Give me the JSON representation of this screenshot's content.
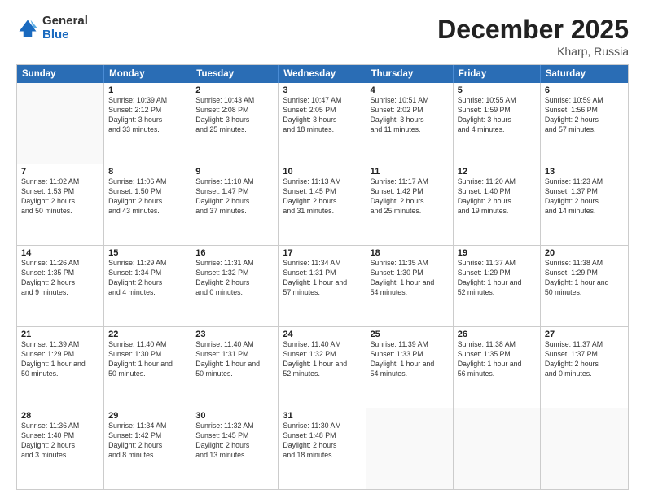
{
  "logo": {
    "general": "General",
    "blue": "Blue"
  },
  "title": {
    "month": "December 2025",
    "location": "Kharp, Russia"
  },
  "header_days": [
    "Sunday",
    "Monday",
    "Tuesday",
    "Wednesday",
    "Thursday",
    "Friday",
    "Saturday"
  ],
  "weeks": [
    [
      {
        "day": "",
        "info": ""
      },
      {
        "day": "1",
        "info": "Sunrise: 10:39 AM\nSunset: 2:12 PM\nDaylight: 3 hours\nand 33 minutes."
      },
      {
        "day": "2",
        "info": "Sunrise: 10:43 AM\nSunset: 2:08 PM\nDaylight: 3 hours\nand 25 minutes."
      },
      {
        "day": "3",
        "info": "Sunrise: 10:47 AM\nSunset: 2:05 PM\nDaylight: 3 hours\nand 18 minutes."
      },
      {
        "day": "4",
        "info": "Sunrise: 10:51 AM\nSunset: 2:02 PM\nDaylight: 3 hours\nand 11 minutes."
      },
      {
        "day": "5",
        "info": "Sunrise: 10:55 AM\nSunset: 1:59 PM\nDaylight: 3 hours\nand 4 minutes."
      },
      {
        "day": "6",
        "info": "Sunrise: 10:59 AM\nSunset: 1:56 PM\nDaylight: 2 hours\nand 57 minutes."
      }
    ],
    [
      {
        "day": "7",
        "info": "Sunrise: 11:02 AM\nSunset: 1:53 PM\nDaylight: 2 hours\nand 50 minutes."
      },
      {
        "day": "8",
        "info": "Sunrise: 11:06 AM\nSunset: 1:50 PM\nDaylight: 2 hours\nand 43 minutes."
      },
      {
        "day": "9",
        "info": "Sunrise: 11:10 AM\nSunset: 1:47 PM\nDaylight: 2 hours\nand 37 minutes."
      },
      {
        "day": "10",
        "info": "Sunrise: 11:13 AM\nSunset: 1:45 PM\nDaylight: 2 hours\nand 31 minutes."
      },
      {
        "day": "11",
        "info": "Sunrise: 11:17 AM\nSunset: 1:42 PM\nDaylight: 2 hours\nand 25 minutes."
      },
      {
        "day": "12",
        "info": "Sunrise: 11:20 AM\nSunset: 1:40 PM\nDaylight: 2 hours\nand 19 minutes."
      },
      {
        "day": "13",
        "info": "Sunrise: 11:23 AM\nSunset: 1:37 PM\nDaylight: 2 hours\nand 14 minutes."
      }
    ],
    [
      {
        "day": "14",
        "info": "Sunrise: 11:26 AM\nSunset: 1:35 PM\nDaylight: 2 hours\nand 9 minutes."
      },
      {
        "day": "15",
        "info": "Sunrise: 11:29 AM\nSunset: 1:34 PM\nDaylight: 2 hours\nand 4 minutes."
      },
      {
        "day": "16",
        "info": "Sunrise: 11:31 AM\nSunset: 1:32 PM\nDaylight: 2 hours\nand 0 minutes."
      },
      {
        "day": "17",
        "info": "Sunrise: 11:34 AM\nSunset: 1:31 PM\nDaylight: 1 hour and\n57 minutes."
      },
      {
        "day": "18",
        "info": "Sunrise: 11:35 AM\nSunset: 1:30 PM\nDaylight: 1 hour and\n54 minutes."
      },
      {
        "day": "19",
        "info": "Sunrise: 11:37 AM\nSunset: 1:29 PM\nDaylight: 1 hour and\n52 minutes."
      },
      {
        "day": "20",
        "info": "Sunrise: 11:38 AM\nSunset: 1:29 PM\nDaylight: 1 hour and\n50 minutes."
      }
    ],
    [
      {
        "day": "21",
        "info": "Sunrise: 11:39 AM\nSunset: 1:29 PM\nDaylight: 1 hour and\n50 minutes."
      },
      {
        "day": "22",
        "info": "Sunrise: 11:40 AM\nSunset: 1:30 PM\nDaylight: 1 hour and\n50 minutes."
      },
      {
        "day": "23",
        "info": "Sunrise: 11:40 AM\nSunset: 1:31 PM\nDaylight: 1 hour and\n50 minutes."
      },
      {
        "day": "24",
        "info": "Sunrise: 11:40 AM\nSunset: 1:32 PM\nDaylight: 1 hour and\n52 minutes."
      },
      {
        "day": "25",
        "info": "Sunrise: 11:39 AM\nSunset: 1:33 PM\nDaylight: 1 hour and\n54 minutes."
      },
      {
        "day": "26",
        "info": "Sunrise: 11:38 AM\nSunset: 1:35 PM\nDaylight: 1 hour and\n56 minutes."
      },
      {
        "day": "27",
        "info": "Sunrise: 11:37 AM\nSunset: 1:37 PM\nDaylight: 2 hours\nand 0 minutes."
      }
    ],
    [
      {
        "day": "28",
        "info": "Sunrise: 11:36 AM\nSunset: 1:40 PM\nDaylight: 2 hours\nand 3 minutes."
      },
      {
        "day": "29",
        "info": "Sunrise: 11:34 AM\nSunset: 1:42 PM\nDaylight: 2 hours\nand 8 minutes."
      },
      {
        "day": "30",
        "info": "Sunrise: 11:32 AM\nSunset: 1:45 PM\nDaylight: 2 hours\nand 13 minutes."
      },
      {
        "day": "31",
        "info": "Sunrise: 11:30 AM\nSunset: 1:48 PM\nDaylight: 2 hours\nand 18 minutes."
      },
      {
        "day": "",
        "info": ""
      },
      {
        "day": "",
        "info": ""
      },
      {
        "day": "",
        "info": ""
      }
    ]
  ]
}
